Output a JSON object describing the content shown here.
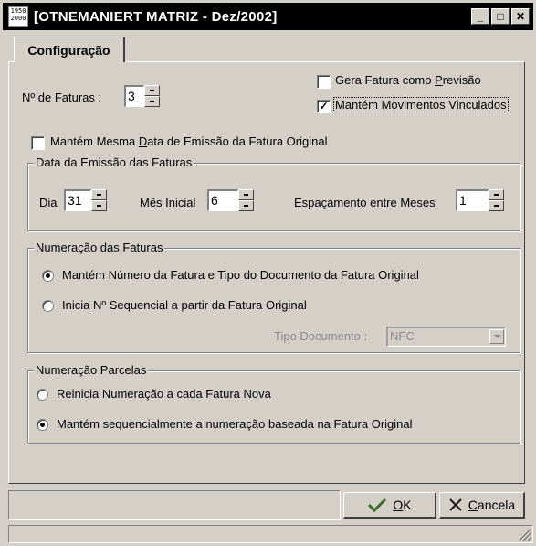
{
  "window": {
    "title": "[OTNEMANIERT MATRIZ - Dez/2002]",
    "icon_text": "1950 2000",
    "controls": [
      "_",
      "□",
      "✕"
    ]
  },
  "tab": {
    "label": "Configuração"
  },
  "faturas": {
    "label": "Nº de Faturas :",
    "value": "3"
  },
  "options": {
    "gera_fatura": {
      "label_pre": "Gera Fatura como ",
      "label_ul": "P",
      "label_post": "revisão",
      "checked": false
    },
    "mantem_movimentos": {
      "label": "Mantém Movimentos Vinculados",
      "checked": true
    },
    "mantem_data": {
      "label_pre": "Mantém Mesma ",
      "label_ul": "D",
      "label_post": "ata de Emissão da Fatura Original",
      "checked": false
    }
  },
  "emissao": {
    "legend": "Data da Emissão das Faturas",
    "dia_label": "Dia",
    "dia_value": "31",
    "mes_label": "Mês Inicial",
    "mes_value": "6",
    "espac_label": "Espaçamento entre Meses",
    "espac_value": "1"
  },
  "numeracao_faturas": {
    "legend": "Numeração das Faturas",
    "opt1": "Mantém Número da Fatura  e Tipo do Documento da Fatura Original",
    "opt2": "Inicia Nº Sequencial a partir da Fatura Original",
    "selected": 1,
    "tipo_doc_label": "Tipo Documento :",
    "tipo_doc_value": "NFC"
  },
  "numeracao_parcelas": {
    "legend": "Numeração Parcelas",
    "opt1": "Reinicia Numeração a cada Fatura Nova",
    "opt2": "Mantém sequencialmente a numeração baseada na Fatura Original",
    "selected": 2
  },
  "buttons": {
    "ok_ul": "O",
    "ok_rest": "K",
    "cancel_ul": "C",
    "cancel_rest": "ancela"
  },
  "colors": {
    "face": "#d4d0c8",
    "titlebar": "#000000",
    "check_icon": "#3a6b2a",
    "cancel_icon": "#1a1a1a"
  }
}
